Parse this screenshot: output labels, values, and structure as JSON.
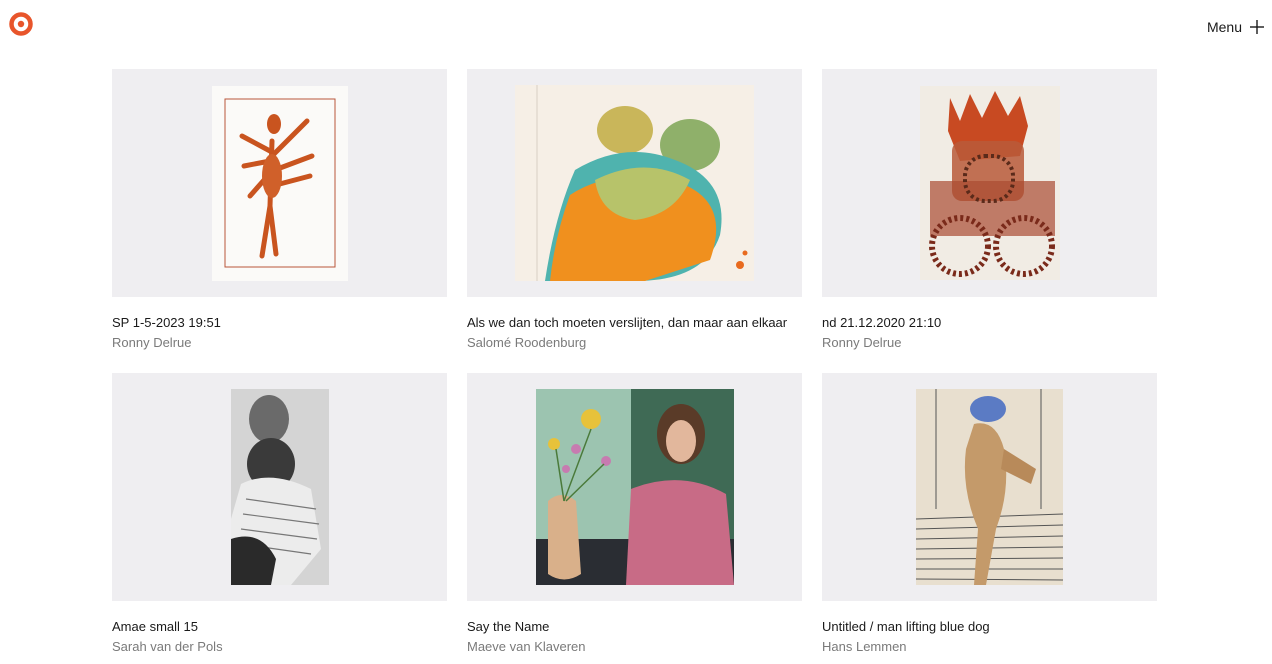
{
  "header": {
    "logo_icon": "ring-logo-icon",
    "brand_color": "#e8552b",
    "menu_label": "Menu",
    "menu_icon": "plus-icon"
  },
  "artworks": [
    {
      "title": "SP 1-5-2023 19:51",
      "artist": "Ronny Delrue"
    },
    {
      "title": "Als we dan toch moeten verslijten, dan maar aan elkaar",
      "artist": "Salomé Roodenburg"
    },
    {
      "title": "nd 21.12.2020 21:10",
      "artist": "Ronny Delrue"
    },
    {
      "title": "Amae small 15",
      "artist": "Sarah van der Pols"
    },
    {
      "title": "Say the Name",
      "artist": "Maeve van Klaveren"
    },
    {
      "title": "Untitled / man lifting blue dog",
      "artist": "Hans Lemmen"
    }
  ]
}
